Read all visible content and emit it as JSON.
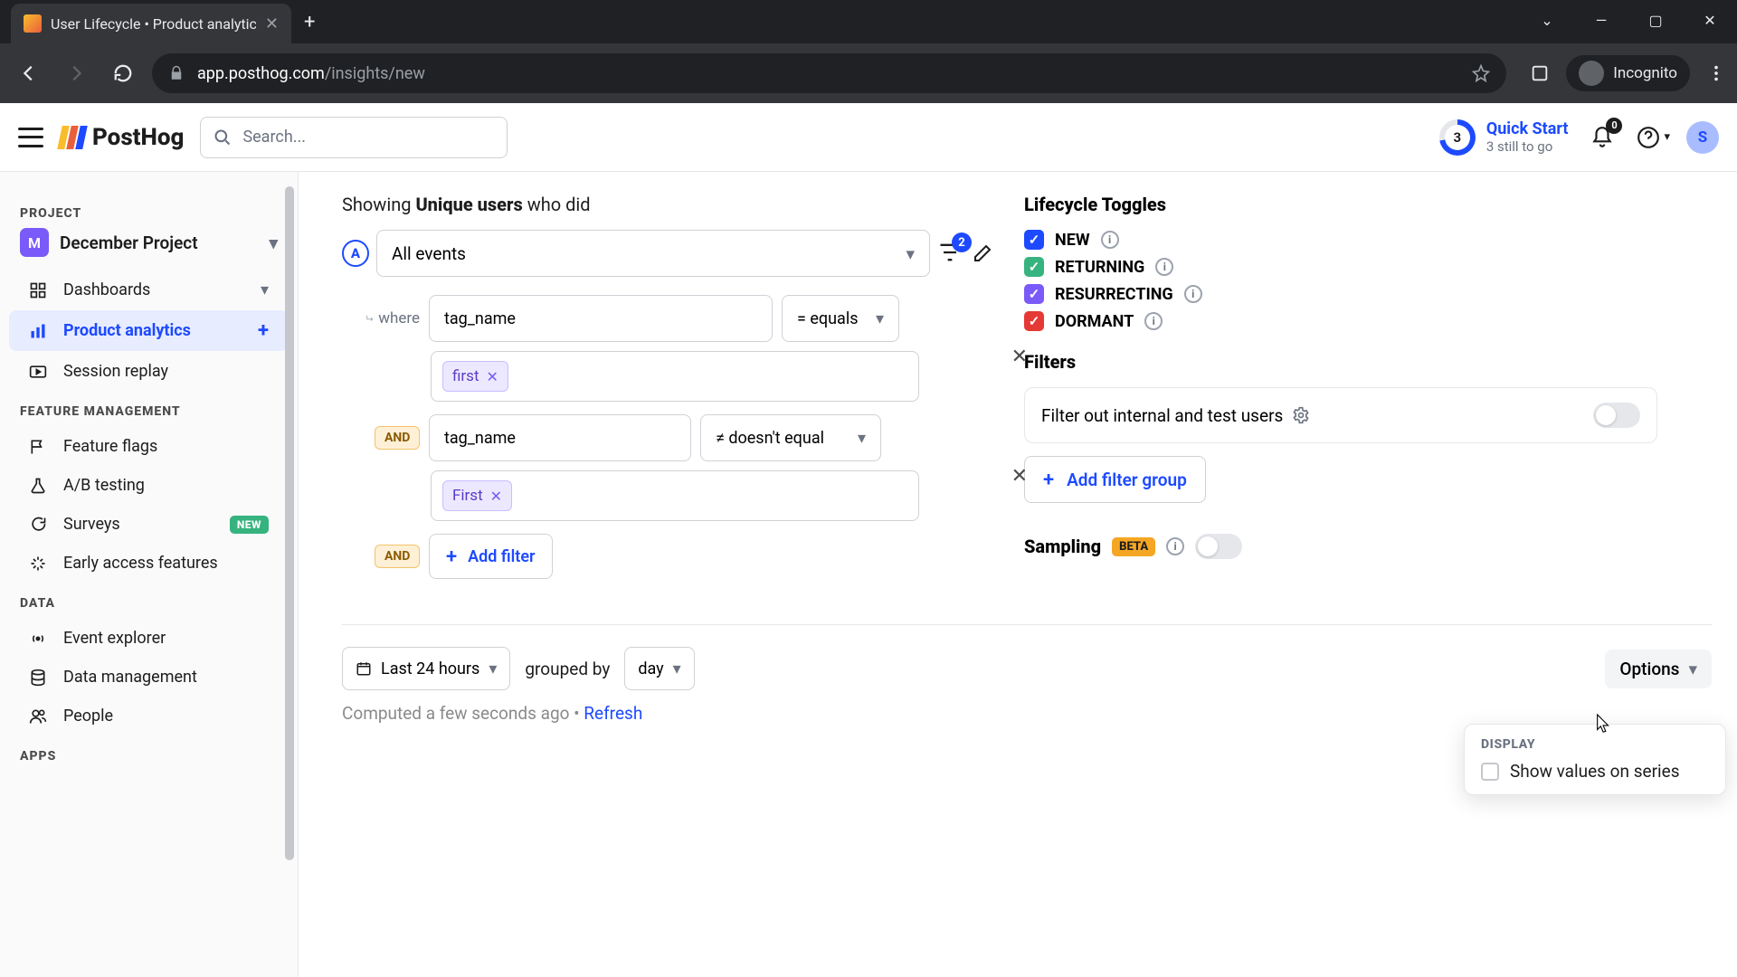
{
  "browser": {
    "tab_title": "User Lifecycle • Product analytic",
    "url_host": "app.posthog.com",
    "url_path": "/insights/new",
    "incognito_label": "Incognito"
  },
  "header": {
    "search_placeholder": "Search...",
    "quick_start_title": "Quick Start",
    "quick_start_sub": "3 still to go",
    "quick_start_count": "3",
    "notification_count": "0",
    "avatar_initial": "S"
  },
  "sidebar": {
    "project_heading": "PROJECT",
    "project_badge": "M",
    "project_name": "December Project",
    "nav": {
      "dashboards": "Dashboards",
      "product_analytics": "Product analytics",
      "session_replay": "Session replay"
    },
    "fm_heading": "FEATURE MANAGEMENT",
    "fm": {
      "feature_flags": "Feature flags",
      "ab_testing": "A/B testing",
      "surveys": "Surveys",
      "surveys_badge": "NEW",
      "early_access": "Early access features"
    },
    "data_heading": "DATA",
    "data": {
      "event_explorer": "Event explorer",
      "data_management": "Data management",
      "people": "People"
    },
    "apps_heading": "APPS"
  },
  "query": {
    "showing_prefix": "Showing ",
    "showing_bold": "Unique users",
    "showing_suffix": " who did",
    "series_letter": "A",
    "event_name": "All events",
    "filter_badge_count": "2",
    "where_label": "where",
    "and_label": "AND",
    "filters": [
      {
        "prop": "tag_name",
        "op": "= equals",
        "value": "first"
      },
      {
        "prop": "tag_name",
        "op": "≠ doesn't equal",
        "value": "First"
      }
    ],
    "add_filter_label": "Add filter"
  },
  "lifecycle": {
    "heading": "Lifecycle Toggles",
    "items": [
      {
        "label": "NEW",
        "color": "blue"
      },
      {
        "label": "RETURNING",
        "color": "green"
      },
      {
        "label": "RESURRECTING",
        "color": "purple"
      },
      {
        "label": "DORMANT",
        "color": "red"
      }
    ]
  },
  "filters_section": {
    "heading": "Filters",
    "internal_label": "Filter out internal and test users",
    "add_group_label": "Add filter group"
  },
  "sampling": {
    "label": "Sampling",
    "beta": "BETA"
  },
  "timebar": {
    "range": "Last 24 hours",
    "grouped_by_label": "grouped by",
    "interval": "day",
    "options_label": "Options"
  },
  "computed": {
    "text": "Computed a few seconds ago • ",
    "refresh": "Refresh"
  },
  "options_popover": {
    "heading": "DISPLAY",
    "row": "Show values on series"
  }
}
